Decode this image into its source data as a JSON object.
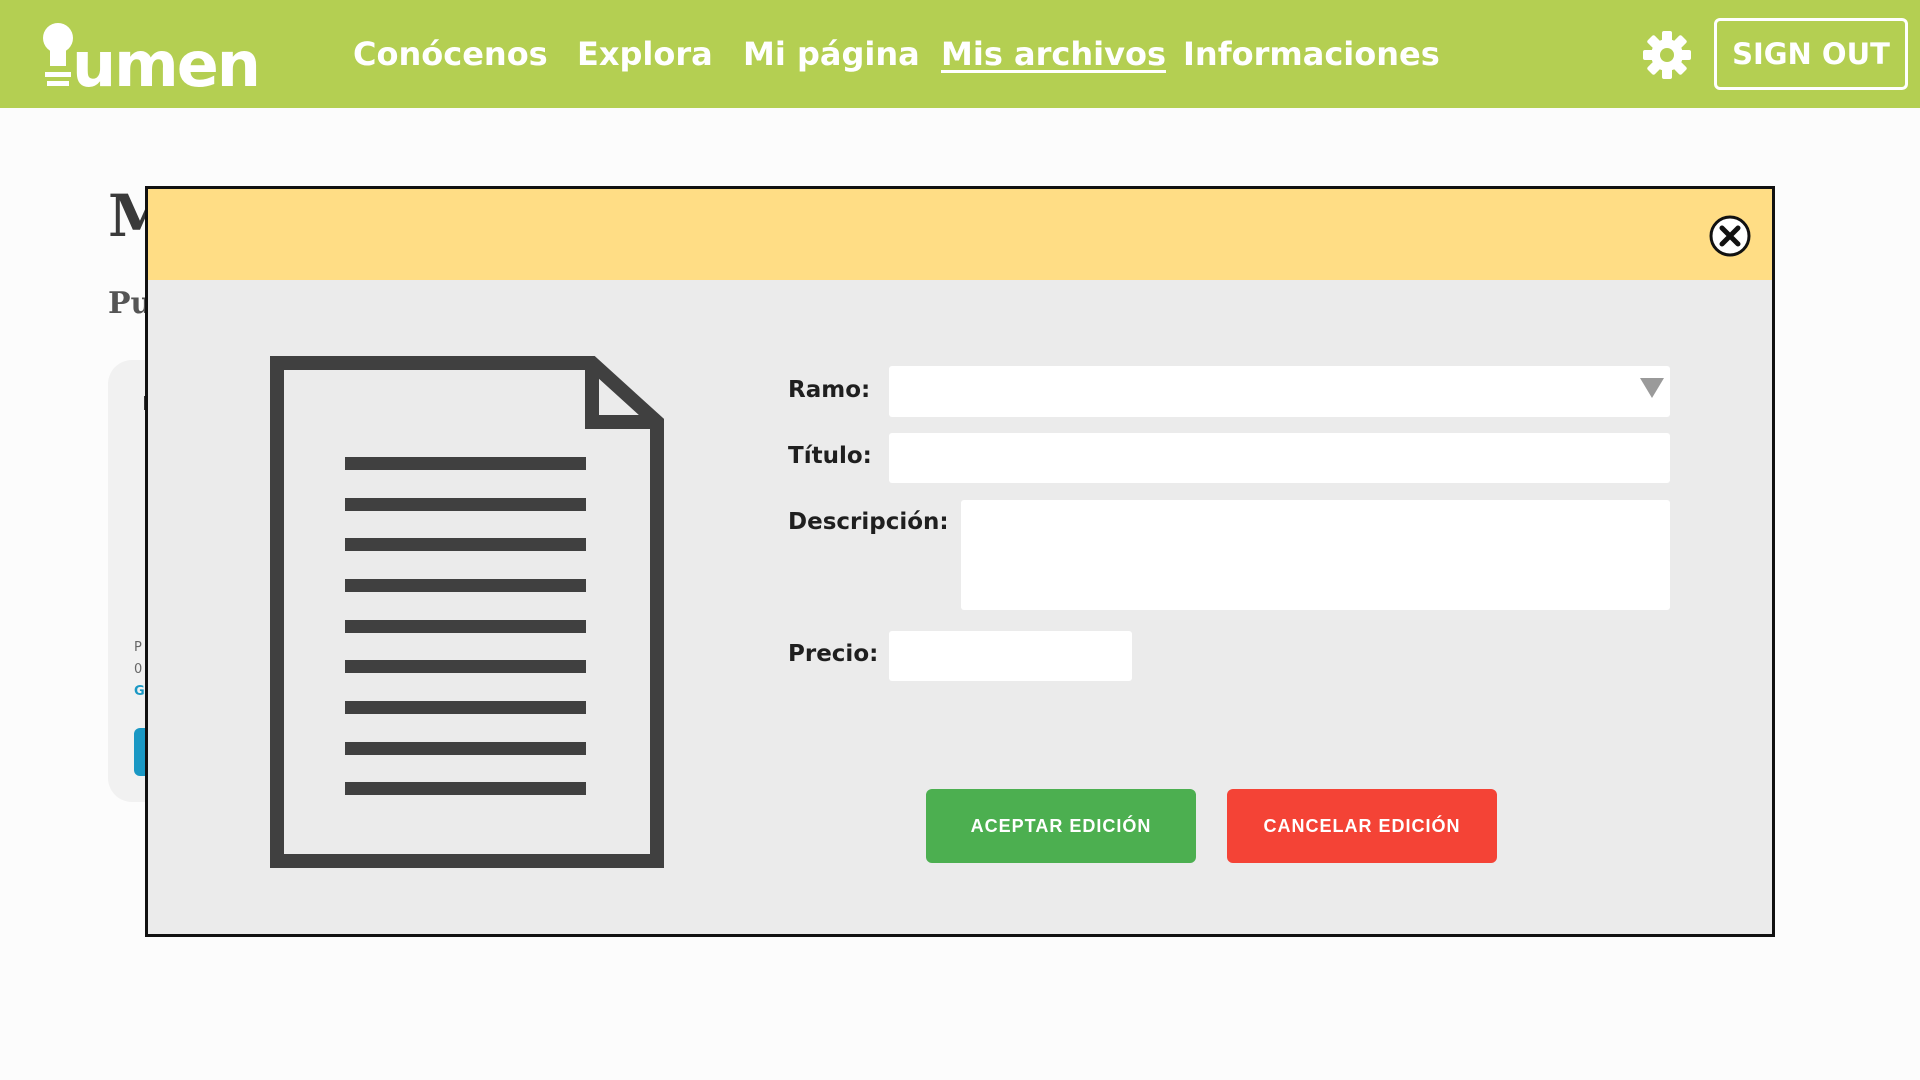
{
  "nav": {
    "logo_text": "lumen",
    "links": [
      {
        "label": "Conócenos",
        "active": false
      },
      {
        "label": "Explora",
        "active": false
      },
      {
        "label": "Mi página",
        "active": false
      },
      {
        "label": "Mis archivos",
        "active": true
      },
      {
        "label": "Informaciones",
        "active": false
      }
    ],
    "settings_icon": "gear-icon",
    "signout_label": "SIGN OUT"
  },
  "background_page": {
    "heading_fragment": "M",
    "subheading_fragment": "Pu",
    "card_text_1": "P",
    "card_text_2": "0",
    "card_text_3": "G"
  },
  "modal": {
    "close_icon": "close-circle-icon",
    "illustration_icon": "document-icon",
    "form": {
      "ramo_label": "Ramo:",
      "ramo_value": "",
      "titulo_label": "Título:",
      "titulo_value": "",
      "descripcion_label": "Descripción:",
      "descripcion_value": "",
      "precio_label": "Precio:",
      "precio_value": ""
    },
    "accept_label": "ACEPTAR EDICIÓN",
    "cancel_label": "CANCELAR EDICIÓN"
  },
  "colors": {
    "nav_bg": "#b4cf52",
    "modal_header": "#ffdd85",
    "modal_body": "#ebebeb",
    "accept": "#4caf50",
    "cancel": "#f44336"
  }
}
